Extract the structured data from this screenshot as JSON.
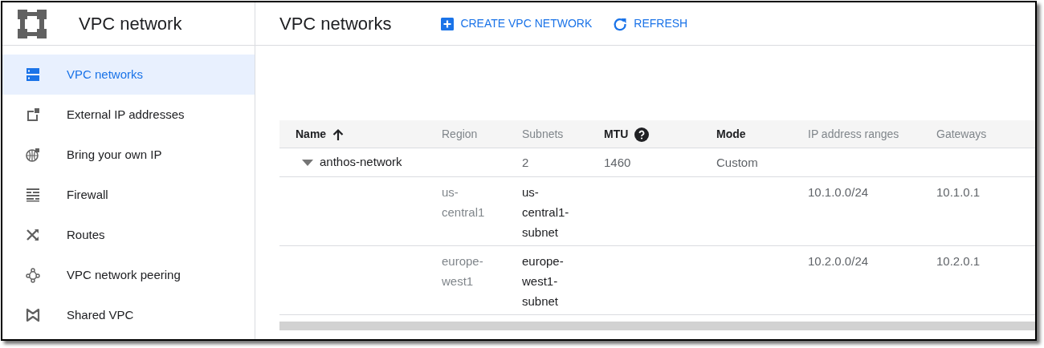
{
  "product": {
    "title": "VPC network"
  },
  "sidebar": {
    "items": [
      {
        "label": "VPC networks",
        "selected": true
      },
      {
        "label": "External IP addresses",
        "selected": false
      },
      {
        "label": "Bring your own IP",
        "selected": false
      },
      {
        "label": "Firewall",
        "selected": false
      },
      {
        "label": "Routes",
        "selected": false
      },
      {
        "label": "VPC network peering",
        "selected": false
      },
      {
        "label": "Shared VPC",
        "selected": false
      }
    ]
  },
  "page": {
    "title": "VPC networks",
    "actions": [
      {
        "label": "CREATE VPC NETWORK"
      },
      {
        "label": "REFRESH"
      }
    ]
  },
  "table": {
    "columns": [
      {
        "label": "Name",
        "sorted": true,
        "help": false
      },
      {
        "label": "Region",
        "sorted": false,
        "help": false
      },
      {
        "label": "Subnets",
        "sorted": false,
        "help": false
      },
      {
        "label": "MTU",
        "sorted": false,
        "help": true
      },
      {
        "label": "Mode",
        "sorted": false,
        "help": false
      },
      {
        "label": "IP address ranges",
        "sorted": false,
        "help": false
      },
      {
        "label": "Gateways",
        "sorted": false,
        "help": false
      }
    ],
    "rows": [
      {
        "kind": "network",
        "expanded": true,
        "name": "anthos-network",
        "subnets": "2",
        "mtu": "1460",
        "mode": "Custom"
      },
      {
        "kind": "subnet",
        "region": "us-central1",
        "subnet": "us-central1-subnet",
        "ip_range": "10.1.0.0/24",
        "gateway": "10.1.0.1"
      },
      {
        "kind": "subnet",
        "region": "europe-west1",
        "subnet": "europe-west1-subnet",
        "ip_range": "10.2.0.0/24",
        "gateway": "10.2.0.1"
      }
    ]
  }
}
